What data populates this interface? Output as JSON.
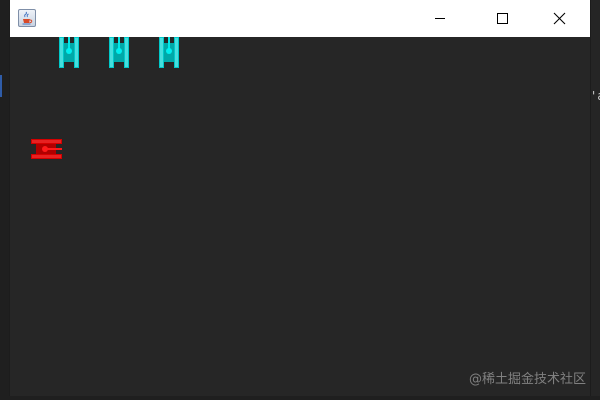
{
  "window": {
    "title": "",
    "icon": "java-cup-icon",
    "controls": {
      "minimize_icon": "minimize-icon",
      "maximize_icon": "maximize-icon",
      "close_icon": "close-icon"
    }
  },
  "game": {
    "background_color": "#262626",
    "enemy_tanks": [
      {
        "color": "#00d2d2",
        "facing": "up"
      },
      {
        "color": "#00d2d2",
        "facing": "up"
      },
      {
        "color": "#00d2d2",
        "facing": "up"
      }
    ],
    "player_tank": {
      "color": "#e00000",
      "facing": "right"
    }
  },
  "side_fragment_text": "'a",
  "watermark": "@稀土掘金技术社区"
}
